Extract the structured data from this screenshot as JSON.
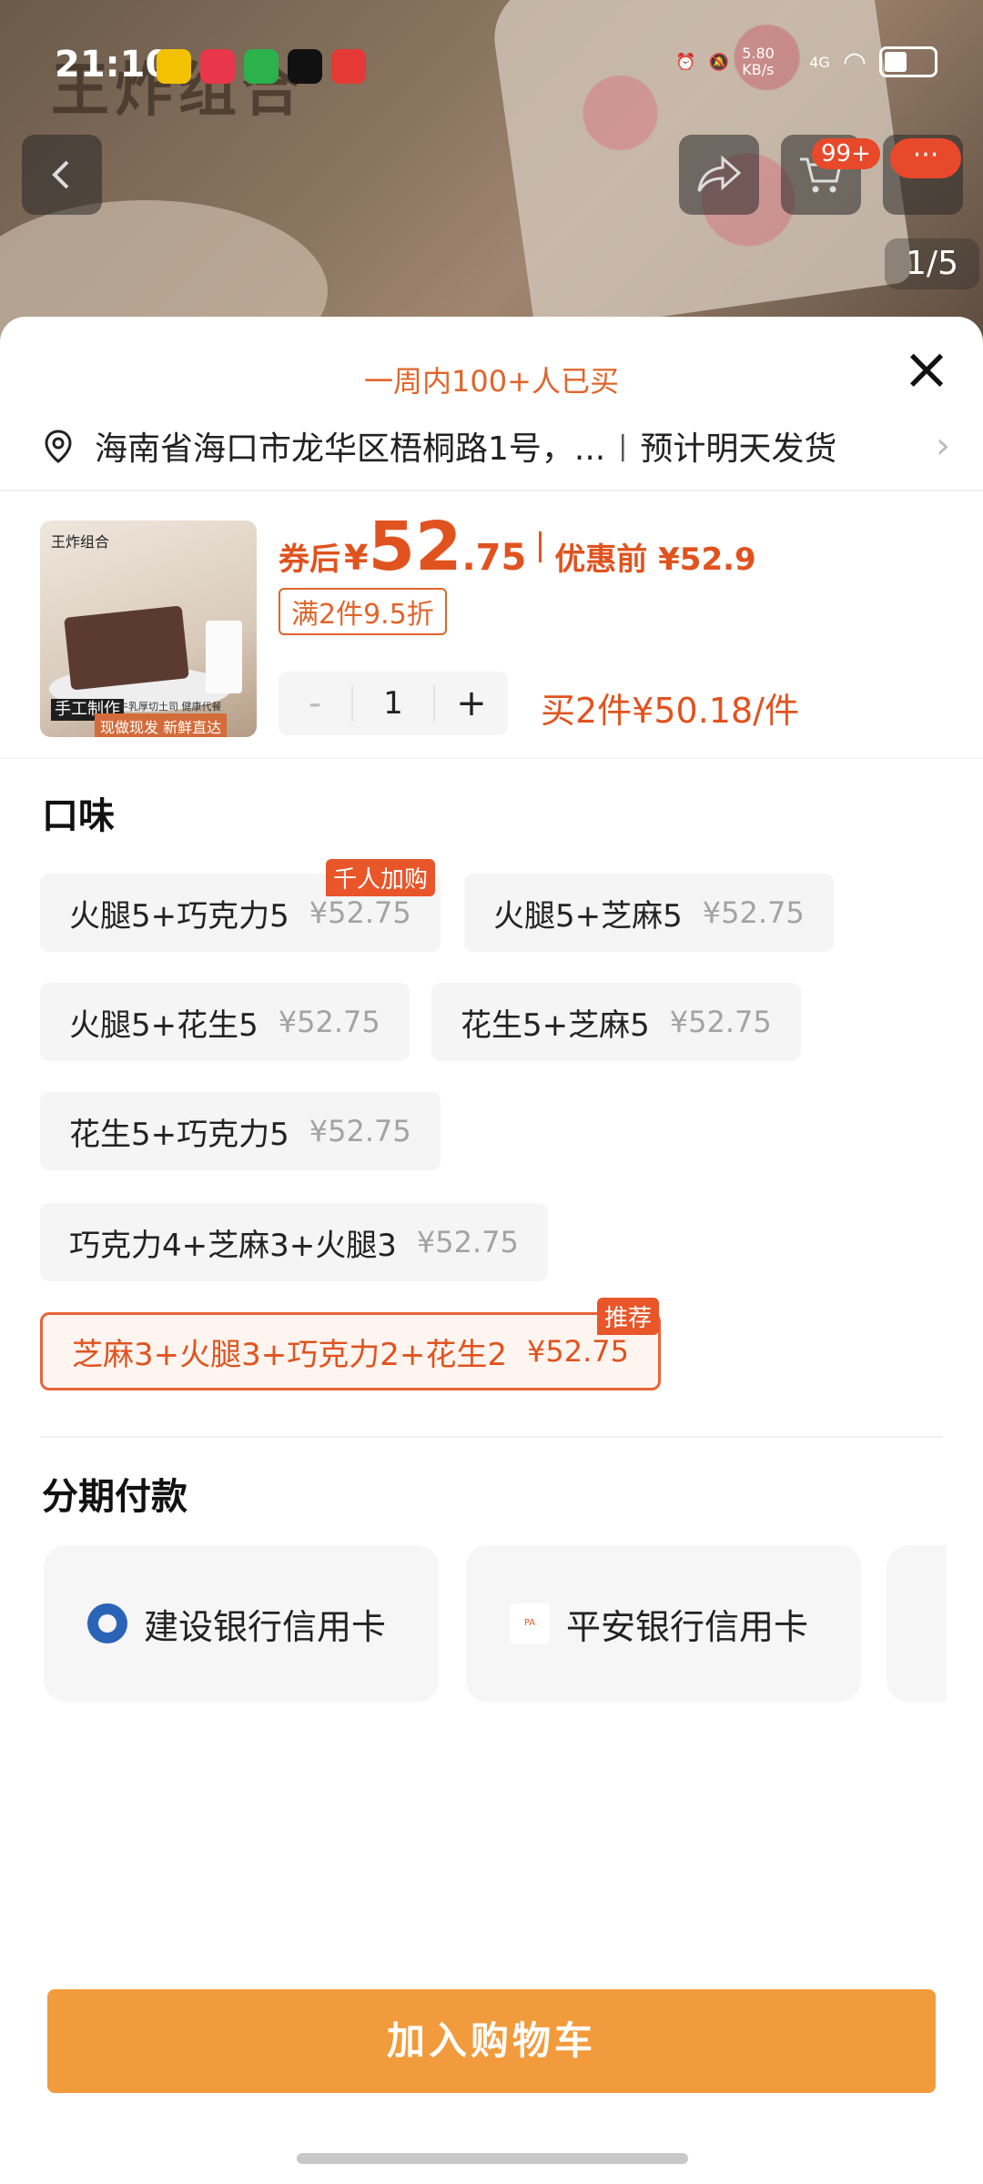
{
  "status_bar": {
    "time": "21:10",
    "net_speed": "5.80 KB/s",
    "signal": "4G"
  },
  "header": {
    "cart_badge": "99+",
    "more_label": "···",
    "page_indicator": "1/5",
    "bg_title": "王炸组合"
  },
  "sheet": {
    "bought_text": "一周内100+人已买",
    "address": "海南省海口市龙华区梧桐路1号，...",
    "delivery": "预计明天发货",
    "thumb": {
      "label": "王炸组合",
      "hand": "手工制作",
      "small": "牛乳厚切土司 健康代餐",
      "fresh": "现做现发 新鲜直达"
    },
    "price": {
      "after_label": "券后",
      "yen": "¥",
      "int": "52",
      "dec": ".75",
      "before_label": "优惠前 ¥52.9"
    },
    "promo": "满2件9.5折",
    "quantity": "1",
    "minus": "-",
    "plus": "+",
    "bulk_price": "买2件¥50.18/件"
  },
  "flavor": {
    "title": "口味",
    "options": [
      {
        "name": "火腿5+巧克力5",
        "price": "¥52.75",
        "tag": "千人加购"
      },
      {
        "name": "火腿5+芝麻5",
        "price": "¥52.75"
      },
      {
        "name": "火腿5+花生5",
        "price": "¥52.75"
      },
      {
        "name": "花生5+芝麻5",
        "price": "¥52.75"
      },
      {
        "name": "花生5+巧克力5",
        "price": "¥52.75"
      },
      {
        "name": "巧克力4+芝麻3+火腿3",
        "price": "¥52.75"
      },
      {
        "name": "芝麻3+火腿3+巧克力2+花生2",
        "price": "¥52.75",
        "tag": "推荐",
        "selected": true
      }
    ]
  },
  "installment": {
    "title": "分期付款",
    "banks": [
      {
        "name": "建设银行信用卡",
        "icon": "ccb-logo-icon"
      },
      {
        "name": "平安银行信用卡",
        "icon": "pingan-logo-icon"
      }
    ]
  },
  "footer": {
    "add_to_cart": "加入购物车"
  },
  "colors": {
    "accent": "#e0531f",
    "button": "#f29b3c"
  }
}
